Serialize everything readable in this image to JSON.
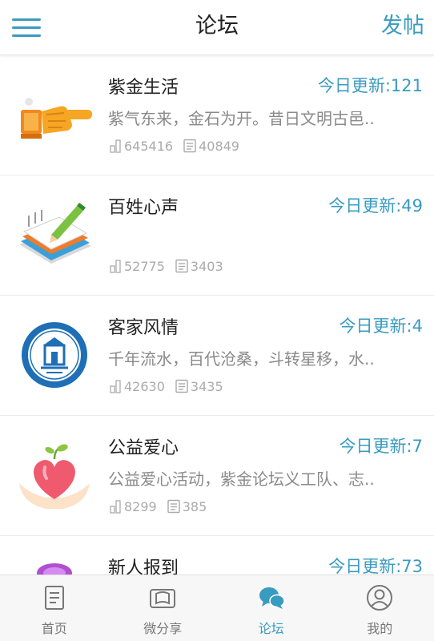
{
  "header": {
    "title": "论坛",
    "post_label": "发帖"
  },
  "colors": {
    "accent": "#3a9bc0",
    "text": "#222222",
    "muted": "#8a8a8a"
  },
  "forums": [
    {
      "icon": "pointing-hand-icon",
      "name": "紫金生活",
      "today": "今日更新:121",
      "desc": "紫气东来，金石为开。昔日文明古邑..",
      "views": "645416",
      "posts": "40849"
    },
    {
      "icon": "notepad-pencil-icon",
      "name": "百姓心声",
      "today": "今日更新:49",
      "desc": "",
      "views": "52775",
      "posts": "3403"
    },
    {
      "icon": "hakka-emblem-icon",
      "name": "客家风情",
      "today": "今日更新:4",
      "desc": "千年流水，百代沧桑，斗转星移，水..",
      "views": "42630",
      "posts": "3435"
    },
    {
      "icon": "heart-hands-icon",
      "name": "公益爱心",
      "today": "今日更新:7",
      "desc": "公益爱心活动，紫金论坛义工队、志..",
      "views": "8299",
      "posts": "385"
    },
    {
      "icon": "newcomer-icon",
      "name": "新人报到",
      "today": "今日更新:73",
      "desc": "",
      "views": "",
      "posts": ""
    }
  ],
  "nav": [
    {
      "label": "首页",
      "icon": "document-icon",
      "active": false
    },
    {
      "label": "微分享",
      "icon": "share-frame-icon",
      "active": false
    },
    {
      "label": "论坛",
      "icon": "chat-bubbles-icon",
      "active": true
    },
    {
      "label": "我的",
      "icon": "profile-icon",
      "active": false
    }
  ]
}
